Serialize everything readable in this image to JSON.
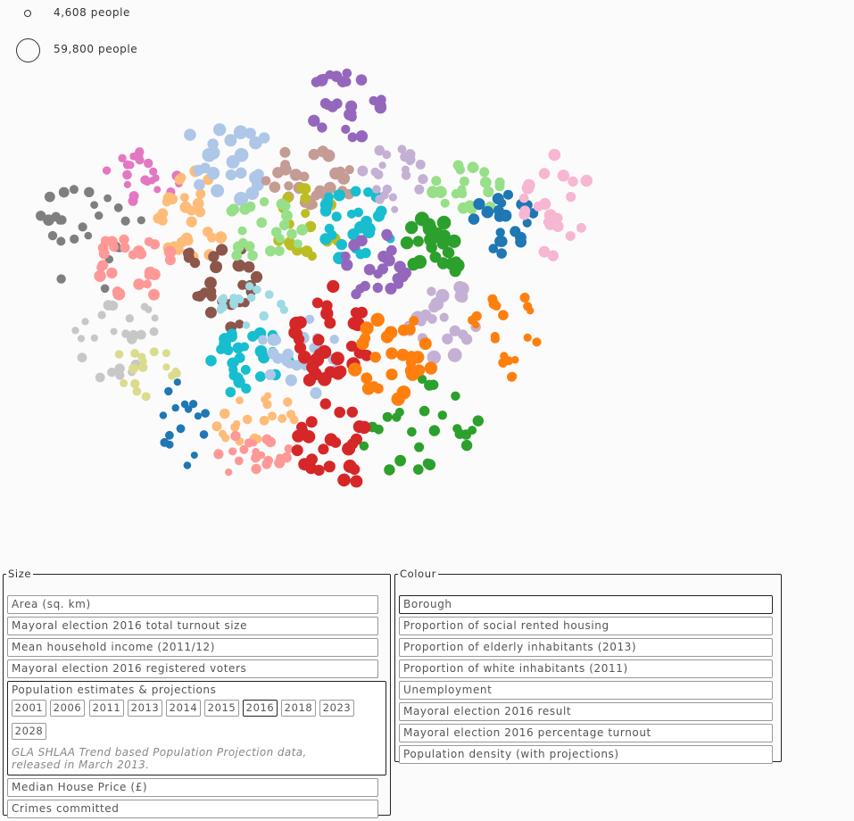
{
  "legend": [
    {
      "label": "4,608 people"
    },
    {
      "label": "59,800 people"
    }
  ],
  "size_panel": {
    "title": "Size",
    "options": [
      "Area (sq. km)",
      "Mayoral election 2016 total turnout size",
      "Mean household income (2011/12)",
      "Mayoral election 2016 registered voters"
    ],
    "population": {
      "title": "Population estimates & projections",
      "years": [
        "2001",
        "2006",
        "2011",
        "2013",
        "2014",
        "2015",
        "2016",
        "2018",
        "2023",
        "2028"
      ],
      "selected_year": "2016",
      "note": "GLA SHLAA Trend based Population Projection data, released in March 2013."
    },
    "options_after": [
      "Median House Price (£)",
      "Crimes committed"
    ]
  },
  "colour_panel": {
    "title": "Colour",
    "options": [
      "Borough",
      "Proportion of social rented housing",
      "Proportion of elderly inhabitants (2013)",
      "Proportion of white inhabitants (2011)",
      "Unemployment",
      "Mayoral election 2016 result",
      "Mayoral election 2016 percentage turnout",
      "Population density (with projections)"
    ],
    "selected": "Borough"
  },
  "colors": {
    "gray": "#7f7f7f",
    "light_gray": "#c7c7c7",
    "olive": "#dbdb8d",
    "steel_blue": "#1f77b4",
    "light_blue": "#aec7e8",
    "pink": "#e377c2",
    "light_orange": "#ffbb78",
    "salmon": "#ff9896",
    "brown": "#8c564b",
    "tan": "#c49c94",
    "cyan": "#17becf",
    "light_cyan": "#9edae5",
    "purple": "#9467bd",
    "lavender": "#c5b0d5",
    "yellow_green": "#bcbd22",
    "light_green": "#98df8a",
    "green": "#2ca02c",
    "red": "#d62728",
    "orange": "#ff7f0e",
    "light_pink": "#f7b6d2"
  }
}
